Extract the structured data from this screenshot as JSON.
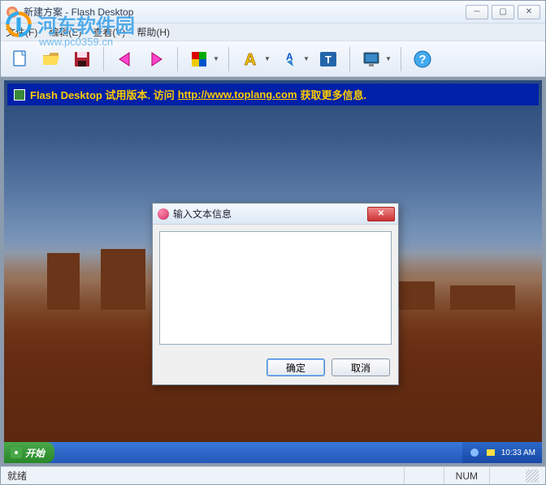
{
  "window": {
    "title": "新建方案 - Flash Desktop"
  },
  "menu": {
    "file": "文件(F)",
    "edit": "编辑(E)",
    "view": "查看(V)",
    "help": "帮助(H)"
  },
  "toolbar": {
    "icons": {
      "new": "new-file-icon",
      "open": "open-folder-icon",
      "save": "save-icon",
      "back": "pink-arrow-left-icon",
      "forward": "pink-arrow-right-icon",
      "color": "color-panel-icon",
      "text_a": "text-style-icon",
      "text_arrow": "text-arrow-icon",
      "text_tt": "text-tt-icon",
      "monitor": "monitor-icon",
      "help": "help-icon"
    }
  },
  "trial": {
    "prefix": "Flash Desktop 试用版本. 访问 ",
    "url": "http://www.toplang.com",
    "suffix": " 获取更多信息."
  },
  "taskbar": {
    "start": "开始",
    "time": "10:33 AM"
  },
  "dialog": {
    "title": "输入文本信息",
    "value": "",
    "ok": "确定",
    "cancel": "取消"
  },
  "statusbar": {
    "ready": "就绪",
    "num": "NUM"
  },
  "watermark": {
    "text": "河东软件园",
    "url": "www.pc0359.cn"
  },
  "colors": {
    "accent_blue": "#2a68c8",
    "trial_bg": "#0020a8",
    "trial_fg": "#ffcc00"
  }
}
